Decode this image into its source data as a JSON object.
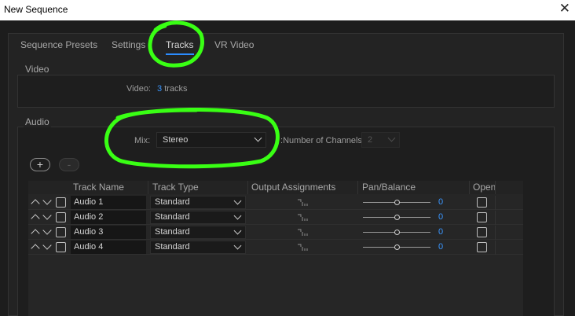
{
  "window": {
    "title": "New Sequence",
    "close_glyph": "✕"
  },
  "tabs": [
    {
      "label": "Sequence Presets",
      "active": false
    },
    {
      "label": "Settings",
      "active": false
    },
    {
      "label": "Tracks",
      "active": true
    },
    {
      "label": "VR Video",
      "active": false
    }
  ],
  "video": {
    "section_title": "Video",
    "label": "Video:",
    "count": "3",
    "unit": "tracks"
  },
  "audio": {
    "section_title": "Audio",
    "mix_label": "Mix:",
    "mix_value": "Stereo",
    "channels_label": "Number of Channels:",
    "channels_value": "2",
    "add_button": "+",
    "remove_button": "-"
  },
  "track_table": {
    "headers": [
      "Track Name",
      "Track Type",
      "Output Assignments",
      "Pan/Balance",
      "Open"
    ],
    "rows": [
      {
        "name": "Audio 1",
        "type": "Standard",
        "pan": "0"
      },
      {
        "name": "Audio 2",
        "type": "Standard",
        "pan": "0"
      },
      {
        "name": "Audio 3",
        "type": "Standard",
        "pan": "0"
      },
      {
        "name": "Audio 4",
        "type": "Standard",
        "pan": "0"
      }
    ]
  },
  "colors": {
    "accent": "#2b8cff",
    "link": "#3a96ff",
    "annotation": "#39ff14"
  },
  "icons": [
    "close-icon",
    "move-up-icon",
    "move-down-icon",
    "output-routing-icon",
    "chevron-down-icon"
  ]
}
